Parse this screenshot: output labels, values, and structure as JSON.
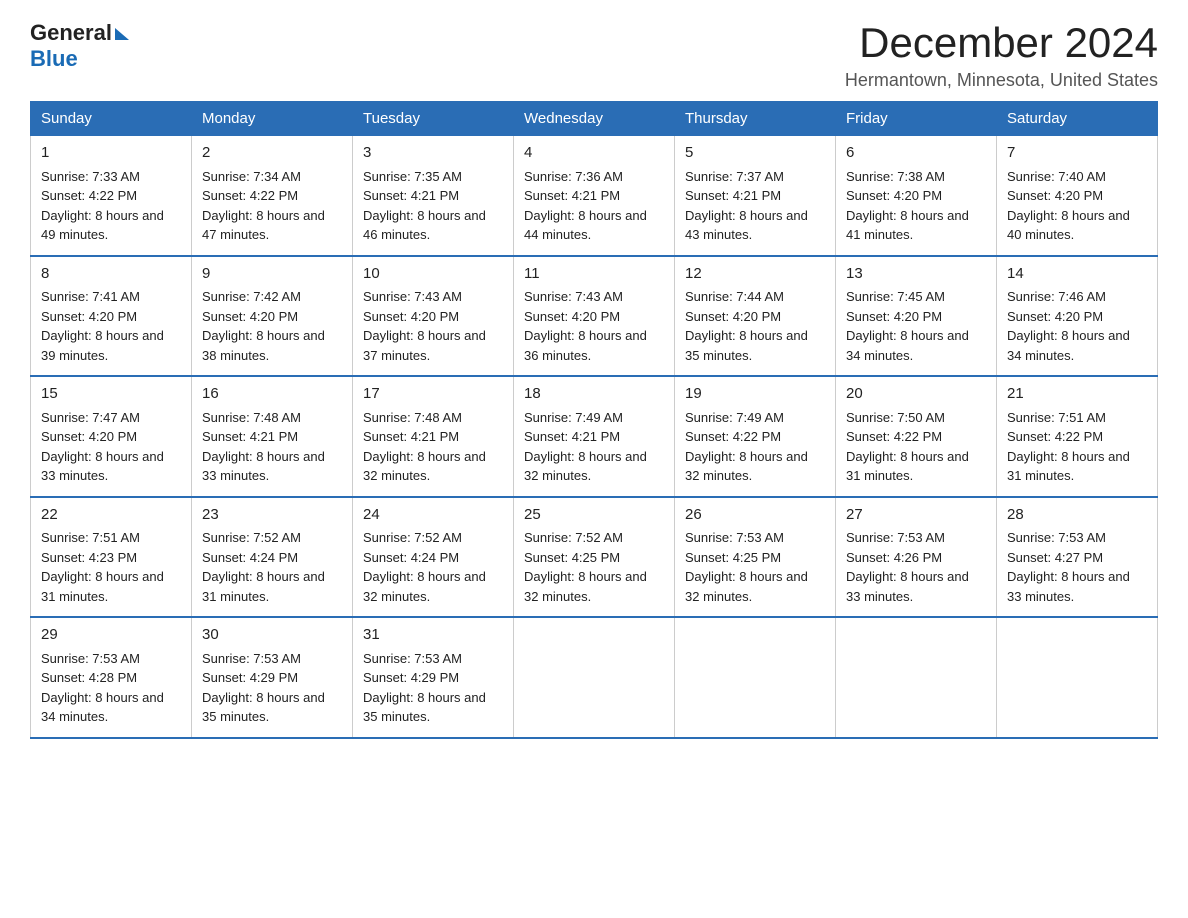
{
  "header": {
    "logo_general": "General",
    "logo_blue": "Blue",
    "month_title": "December 2024",
    "location": "Hermantown, Minnesota, United States"
  },
  "days_of_week": [
    "Sunday",
    "Monday",
    "Tuesday",
    "Wednesday",
    "Thursday",
    "Friday",
    "Saturday"
  ],
  "weeks": [
    [
      {
        "day": "1",
        "sunrise": "Sunrise: 7:33 AM",
        "sunset": "Sunset: 4:22 PM",
        "daylight": "Daylight: 8 hours and 49 minutes."
      },
      {
        "day": "2",
        "sunrise": "Sunrise: 7:34 AM",
        "sunset": "Sunset: 4:22 PM",
        "daylight": "Daylight: 8 hours and 47 minutes."
      },
      {
        "day": "3",
        "sunrise": "Sunrise: 7:35 AM",
        "sunset": "Sunset: 4:21 PM",
        "daylight": "Daylight: 8 hours and 46 minutes."
      },
      {
        "day": "4",
        "sunrise": "Sunrise: 7:36 AM",
        "sunset": "Sunset: 4:21 PM",
        "daylight": "Daylight: 8 hours and 44 minutes."
      },
      {
        "day": "5",
        "sunrise": "Sunrise: 7:37 AM",
        "sunset": "Sunset: 4:21 PM",
        "daylight": "Daylight: 8 hours and 43 minutes."
      },
      {
        "day": "6",
        "sunrise": "Sunrise: 7:38 AM",
        "sunset": "Sunset: 4:20 PM",
        "daylight": "Daylight: 8 hours and 41 minutes."
      },
      {
        "day": "7",
        "sunrise": "Sunrise: 7:40 AM",
        "sunset": "Sunset: 4:20 PM",
        "daylight": "Daylight: 8 hours and 40 minutes."
      }
    ],
    [
      {
        "day": "8",
        "sunrise": "Sunrise: 7:41 AM",
        "sunset": "Sunset: 4:20 PM",
        "daylight": "Daylight: 8 hours and 39 minutes."
      },
      {
        "day": "9",
        "sunrise": "Sunrise: 7:42 AM",
        "sunset": "Sunset: 4:20 PM",
        "daylight": "Daylight: 8 hours and 38 minutes."
      },
      {
        "day": "10",
        "sunrise": "Sunrise: 7:43 AM",
        "sunset": "Sunset: 4:20 PM",
        "daylight": "Daylight: 8 hours and 37 minutes."
      },
      {
        "day": "11",
        "sunrise": "Sunrise: 7:43 AM",
        "sunset": "Sunset: 4:20 PM",
        "daylight": "Daylight: 8 hours and 36 minutes."
      },
      {
        "day": "12",
        "sunrise": "Sunrise: 7:44 AM",
        "sunset": "Sunset: 4:20 PM",
        "daylight": "Daylight: 8 hours and 35 minutes."
      },
      {
        "day": "13",
        "sunrise": "Sunrise: 7:45 AM",
        "sunset": "Sunset: 4:20 PM",
        "daylight": "Daylight: 8 hours and 34 minutes."
      },
      {
        "day": "14",
        "sunrise": "Sunrise: 7:46 AM",
        "sunset": "Sunset: 4:20 PM",
        "daylight": "Daylight: 8 hours and 34 minutes."
      }
    ],
    [
      {
        "day": "15",
        "sunrise": "Sunrise: 7:47 AM",
        "sunset": "Sunset: 4:20 PM",
        "daylight": "Daylight: 8 hours and 33 minutes."
      },
      {
        "day": "16",
        "sunrise": "Sunrise: 7:48 AM",
        "sunset": "Sunset: 4:21 PM",
        "daylight": "Daylight: 8 hours and 33 minutes."
      },
      {
        "day": "17",
        "sunrise": "Sunrise: 7:48 AM",
        "sunset": "Sunset: 4:21 PM",
        "daylight": "Daylight: 8 hours and 32 minutes."
      },
      {
        "day": "18",
        "sunrise": "Sunrise: 7:49 AM",
        "sunset": "Sunset: 4:21 PM",
        "daylight": "Daylight: 8 hours and 32 minutes."
      },
      {
        "day": "19",
        "sunrise": "Sunrise: 7:49 AM",
        "sunset": "Sunset: 4:22 PM",
        "daylight": "Daylight: 8 hours and 32 minutes."
      },
      {
        "day": "20",
        "sunrise": "Sunrise: 7:50 AM",
        "sunset": "Sunset: 4:22 PM",
        "daylight": "Daylight: 8 hours and 31 minutes."
      },
      {
        "day": "21",
        "sunrise": "Sunrise: 7:51 AM",
        "sunset": "Sunset: 4:22 PM",
        "daylight": "Daylight: 8 hours and 31 minutes."
      }
    ],
    [
      {
        "day": "22",
        "sunrise": "Sunrise: 7:51 AM",
        "sunset": "Sunset: 4:23 PM",
        "daylight": "Daylight: 8 hours and 31 minutes."
      },
      {
        "day": "23",
        "sunrise": "Sunrise: 7:52 AM",
        "sunset": "Sunset: 4:24 PM",
        "daylight": "Daylight: 8 hours and 31 minutes."
      },
      {
        "day": "24",
        "sunrise": "Sunrise: 7:52 AM",
        "sunset": "Sunset: 4:24 PM",
        "daylight": "Daylight: 8 hours and 32 minutes."
      },
      {
        "day": "25",
        "sunrise": "Sunrise: 7:52 AM",
        "sunset": "Sunset: 4:25 PM",
        "daylight": "Daylight: 8 hours and 32 minutes."
      },
      {
        "day": "26",
        "sunrise": "Sunrise: 7:53 AM",
        "sunset": "Sunset: 4:25 PM",
        "daylight": "Daylight: 8 hours and 32 minutes."
      },
      {
        "day": "27",
        "sunrise": "Sunrise: 7:53 AM",
        "sunset": "Sunset: 4:26 PM",
        "daylight": "Daylight: 8 hours and 33 minutes."
      },
      {
        "day": "28",
        "sunrise": "Sunrise: 7:53 AM",
        "sunset": "Sunset: 4:27 PM",
        "daylight": "Daylight: 8 hours and 33 minutes."
      }
    ],
    [
      {
        "day": "29",
        "sunrise": "Sunrise: 7:53 AM",
        "sunset": "Sunset: 4:28 PM",
        "daylight": "Daylight: 8 hours and 34 minutes."
      },
      {
        "day": "30",
        "sunrise": "Sunrise: 7:53 AM",
        "sunset": "Sunset: 4:29 PM",
        "daylight": "Daylight: 8 hours and 35 minutes."
      },
      {
        "day": "31",
        "sunrise": "Sunrise: 7:53 AM",
        "sunset": "Sunset: 4:29 PM",
        "daylight": "Daylight: 8 hours and 35 minutes."
      },
      null,
      null,
      null,
      null
    ]
  ]
}
